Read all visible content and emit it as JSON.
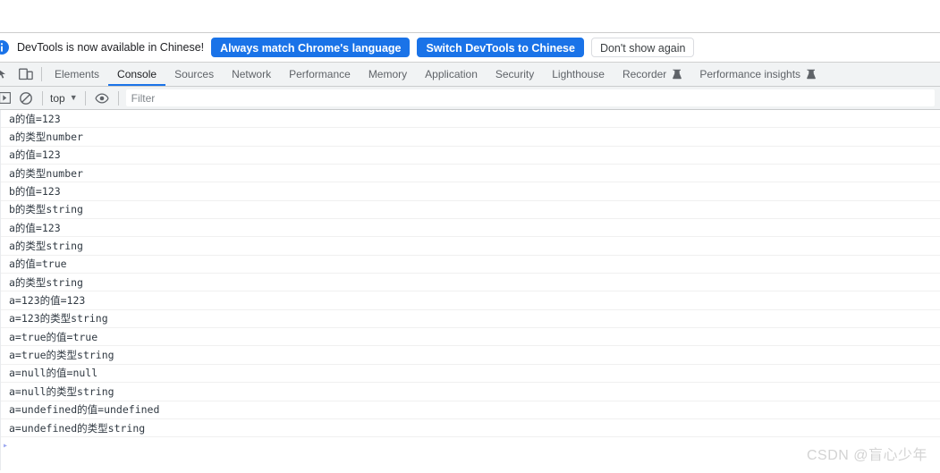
{
  "banner": {
    "icon": "info-circle-icon",
    "message": "DevTools is now available in Chinese!",
    "buttons": [
      {
        "label": "Always match Chrome's language",
        "style": "primary"
      },
      {
        "label": "Switch DevTools to Chinese",
        "style": "primary"
      },
      {
        "label": "Don't show again",
        "style": "secondary"
      }
    ]
  },
  "toolbar_icons": {
    "inspect": "inspect-element-icon",
    "device": "device-toolbar-icon"
  },
  "tabs": [
    {
      "label": "Elements",
      "active": false,
      "flask": false
    },
    {
      "label": "Console",
      "active": true,
      "flask": false
    },
    {
      "label": "Sources",
      "active": false,
      "flask": false
    },
    {
      "label": "Network",
      "active": false,
      "flask": false
    },
    {
      "label": "Performance",
      "active": false,
      "flask": false
    },
    {
      "label": "Memory",
      "active": false,
      "flask": false
    },
    {
      "label": "Application",
      "active": false,
      "flask": false
    },
    {
      "label": "Security",
      "active": false,
      "flask": false
    },
    {
      "label": "Lighthouse",
      "active": false,
      "flask": false
    },
    {
      "label": "Recorder",
      "active": false,
      "flask": true
    },
    {
      "label": "Performance insights",
      "active": false,
      "flask": true
    }
  ],
  "console_toolbar": {
    "sidebar_toggle_icon": "console-sidebar-toggle-icon",
    "clear_icon": "clear-console-icon",
    "context_label": "top",
    "context_caret": "▼",
    "eye_icon": "live-expression-eye-icon",
    "filter_placeholder": "Filter",
    "filter_value": ""
  },
  "console_messages": [
    "a的值=123",
    "a的类型number",
    "a的值=123",
    "a的类型number",
    "b的值=123",
    "b的类型string",
    "a的值=123",
    "a的类型string",
    "a的值=true",
    "a的类型string",
    "a=123的值=123",
    "a=123的类型string",
    "a=true的值=true",
    "a=true的类型string",
    "a=null的值=null",
    "a=null的类型string",
    "a=undefined的值=undefined",
    "a=undefined的类型string"
  ],
  "console_prompt": {
    "caret": "▸",
    "value": ""
  },
  "watermark": {
    "text": "CSDN @盲心少年"
  },
  "colors": {
    "accent_blue": "#1a73e8",
    "toolbar_bg": "#f1f3f4",
    "text_primary": "#202124",
    "text_secondary": "#5f6368",
    "console_text": "#303942",
    "watermark": "#d3d3d3"
  }
}
